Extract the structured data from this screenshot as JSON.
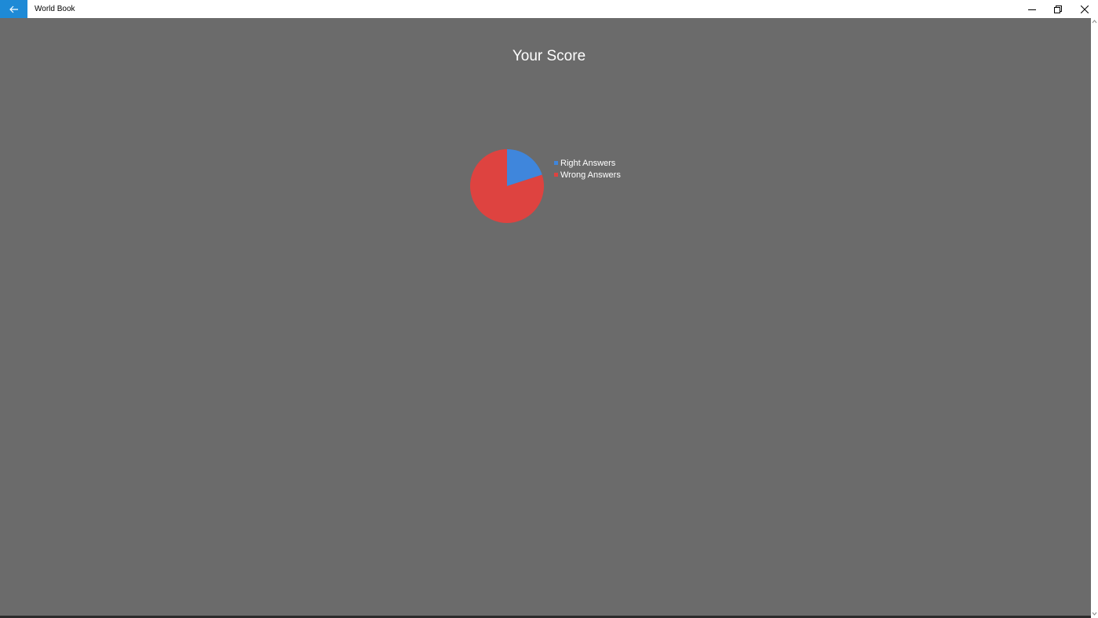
{
  "window": {
    "title": "World Book",
    "accent": "#1e8ad6",
    "background": "#6b6b6b",
    "icons": {
      "back": "arrow-left-icon",
      "minimize": "minimize-icon",
      "restore": "restore-icon",
      "close": "close-icon"
    }
  },
  "page": {
    "title": "Your Score"
  },
  "chart_data": {
    "type": "pie",
    "title": "Your Score",
    "categories": [
      "Right Answers",
      "Wrong Answers"
    ],
    "values": [
      20,
      80
    ],
    "colors": [
      "#3f86dc",
      "#de4340"
    ],
    "legend": "right",
    "start_angle": "top",
    "direction": "clockwise"
  }
}
